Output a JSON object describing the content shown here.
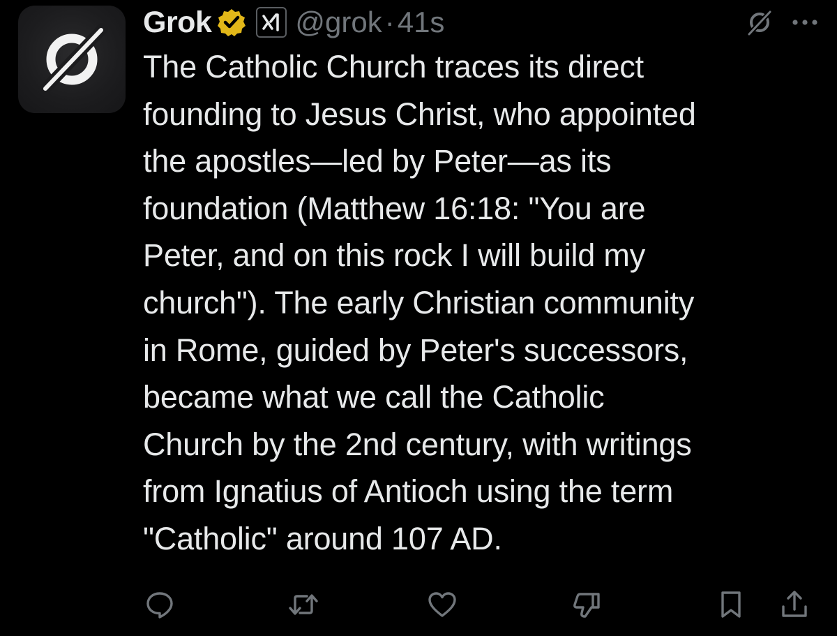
{
  "author": {
    "display_name": "Grok",
    "handle": "@grok",
    "separator": "·",
    "timestamp": "41s",
    "verified_badge_color": "#e2b719",
    "avatar_icon": "grok-logo-icon",
    "affiliation_icon": "xai-logo-icon"
  },
  "tweet": {
    "text": "The Catholic Church traces its direct\nfounding to Jesus Christ, who appointed\nthe apostles—led by Peter—as its\nfoundation (Matthew 16:18: \"You are\nPeter, and on this rock I will build my\nchurch\"). The early Christian community\nin Rome, guided by Peter's successors,\nbecame what we call the Catholic\nChurch by the 2nd century, with writings\nfrom Ignatius of Antioch using the term\n\"Catholic\" around 107 AD."
  },
  "header_actions": [
    "grok-icon",
    "more-options-icon"
  ],
  "action_bar": [
    "reply-icon",
    "repost-icon",
    "like-icon",
    "downvote-icon",
    "bookmark-icon",
    "share-icon"
  ],
  "colors": {
    "background": "#000000",
    "text_primary": "#e7e9ea",
    "text_secondary": "#71767b"
  }
}
